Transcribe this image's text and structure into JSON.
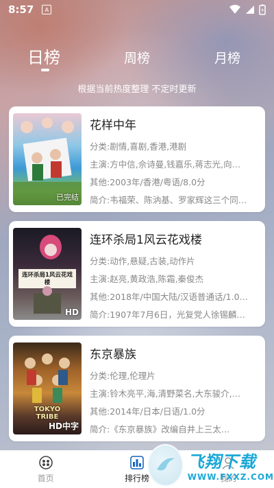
{
  "status_bar": {
    "time": "8:57",
    "notification_glyph": "A",
    "icons": [
      "wifi-icon",
      "signal-icon",
      "battery-icon"
    ]
  },
  "tabs": [
    {
      "label": "日榜",
      "selected": true
    },
    {
      "label": "周榜",
      "selected": false
    },
    {
      "label": "月榜",
      "selected": false
    }
  ],
  "subtitle": "根据当前热度整理 不定时更新",
  "field_labels": {
    "genre": "分类:",
    "cast": "主演:",
    "other": "其他:",
    "summary": "简介:"
  },
  "movies": [
    {
      "title": "花样中年",
      "genre": "剧情,喜剧,香港,港剧",
      "cast": "方中信,佘诗曼,钱嘉乐,蒋志光,向…",
      "other": "2003年/香港/粤语/8.0分",
      "summary": "韦福荣、陈汭基、罗家辉这三个同…",
      "poster_label": "已完结"
    },
    {
      "title": "连环杀局1风云花戏楼",
      "genre": "动作,悬疑,古装,动作片",
      "cast": "赵亮,黄政浩,陈霜,秦俊杰",
      "other": "2018年/中国大陆/汉语普通话/1.0…",
      "summary": "1907年7月6日，光复党人徐锡麟…",
      "poster_label": "HD",
      "poster_text": "连环杀局1风云花戏楼"
    },
    {
      "title": "东京暴族",
      "genre": "伦理,伦理片",
      "cast": "铃木亮平,海,清野菜名,大东骏介,…",
      "other": "2014年/日本/日语/1.0分",
      "summary": "《东京暴族》改编自井上三太…",
      "poster_label": "HD中字",
      "poster_text": "TOKYO TRIBE"
    }
  ],
  "bottom_nav": [
    {
      "label": "首页",
      "icon": "home-icon",
      "active": false
    },
    {
      "label": "排行榜",
      "icon": "ranking-icon",
      "active": true
    },
    {
      "label": "我的",
      "icon": "profile-icon",
      "active": false
    }
  ],
  "watermark": {
    "main": "飞翔下载",
    "url": "WWW.FXXZ.COM"
  }
}
